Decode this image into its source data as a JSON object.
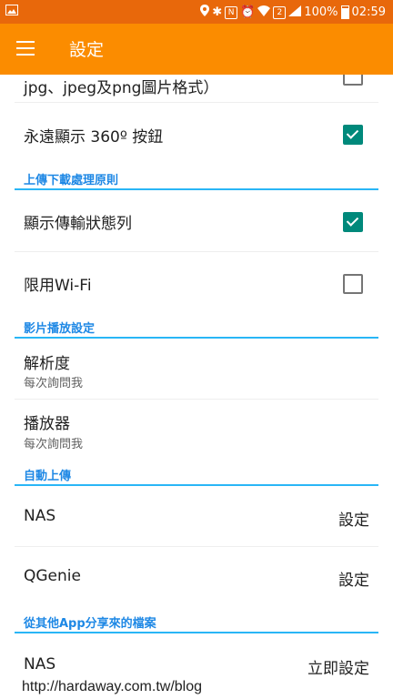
{
  "status_bar": {
    "battery": "100%",
    "time": "02:59",
    "sim_label": "2",
    "icons": [
      "gallery-icon",
      "location-icon",
      "bluetooth-icon",
      "nfc-icon",
      "alarm-icon",
      "wifi-icon",
      "signal-icon",
      "battery-icon"
    ]
  },
  "app_bar": {
    "title": "設定",
    "menu_icon": "hamburger-menu-icon"
  },
  "rows": {
    "formats": "jpg、jpeg及png圖片格式）",
    "show_360": "永遠顯示 360º 按鈕",
    "show_transfer": "顯示傳輸狀態列",
    "wifi_only": "限用Wi-Fi",
    "resolution": "解析度",
    "resolution_sub": "每次詢問我",
    "player": "播放器",
    "player_sub": "每次詢問我",
    "nas": "NAS",
    "nas_action": "設定",
    "qgenie": "QGenie",
    "qgenie_action": "設定",
    "nas2": "NAS",
    "nas2_action": "立即設定"
  },
  "checkboxes": {
    "formats": false,
    "show_360": true,
    "show_transfer": true,
    "wifi_only": false
  },
  "sections": {
    "transfer": "上傳下載處理原則",
    "video": "影片播放設定",
    "auto_upload": "自動上傳",
    "share": "從其他App分享來的檔案"
  },
  "watermark": "http://hardaway.com.tw/blog",
  "colors": {
    "status_bar": "#e8680b",
    "app_bar": "#fb8c00",
    "section_title": "#1e88e5",
    "section_line": "#29b6f6",
    "checkbox_on": "#00897b"
  }
}
